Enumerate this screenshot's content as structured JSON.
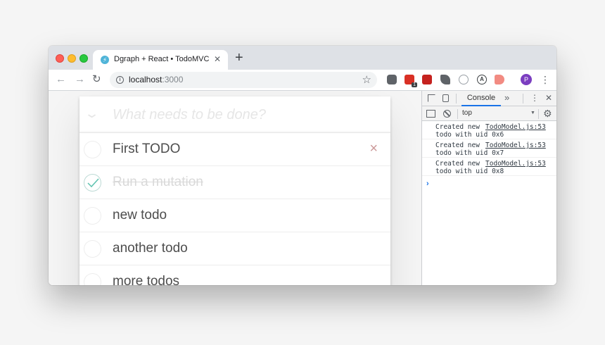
{
  "browser": {
    "tab_title": "Dgraph + React • TodoMVC",
    "tab_close": "✕",
    "new_tab": "+",
    "favicon_glyph": "⚡",
    "url_host": "localhost",
    "url_port": ":3000",
    "profile_initial": "P",
    "extension_badge": "1",
    "icons": {
      "back": "back-arrow-icon",
      "forward": "forward-arrow-icon",
      "reload": "reload-icon",
      "bookmark": "star-icon",
      "menu": "kebab-menu-icon"
    }
  },
  "todo": {
    "placeholder": "What needs to be done?",
    "items": [
      {
        "label": "First TODO",
        "completed": false
      },
      {
        "label": "Run a mutation",
        "completed": true
      },
      {
        "label": "new todo",
        "completed": false
      },
      {
        "label": "another todo",
        "completed": false
      },
      {
        "label": "more todos",
        "completed": false
      }
    ],
    "destroy_glyph": "×"
  },
  "devtools": {
    "active_tab": "Console",
    "more_tabs": "»",
    "context": "top",
    "logs": [
      {
        "line1": "Created new",
        "source": "TodoModel.js:53",
        "line2": "todo with uid 0x6"
      },
      {
        "line1": "Created new",
        "source": "TodoModel.js:53",
        "line2": "todo with uid 0x7"
      },
      {
        "line1": "Created new",
        "source": "TodoModel.js:53",
        "line2": "todo with uid 0x8"
      }
    ],
    "prompt": "›"
  },
  "colors": {
    "accent": "#1a73e8",
    "check_green": "#5dc2af",
    "destroy_red": "#cc9a9a"
  }
}
